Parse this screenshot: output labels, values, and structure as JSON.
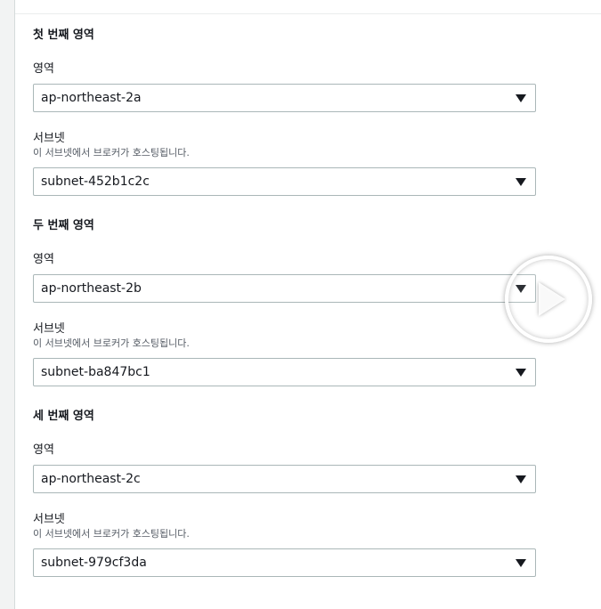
{
  "zones": [
    {
      "title": "첫 번째 영역",
      "az_label": "영역",
      "az_value": "ap-northeast-2a",
      "subnet_label": "서브넷",
      "subnet_desc": "이 서브넷에서 브로커가 호스팅됩니다.",
      "subnet_value": "subnet-452b1c2c"
    },
    {
      "title": "두 번째 영역",
      "az_label": "영역",
      "az_value": "ap-northeast-2b",
      "subnet_label": "서브넷",
      "subnet_desc": "이 서브넷에서 브로커가 호스팅됩니다.",
      "subnet_value": "subnet-ba847bc1"
    },
    {
      "title": "세 번째 영역",
      "az_label": "영역",
      "az_value": "ap-northeast-2c",
      "subnet_label": "서브넷",
      "subnet_desc": "이 서브넷에서 브로커가 호스팅됩니다.",
      "subnet_value": "subnet-979cf3da"
    }
  ],
  "icons": {
    "dropdown": "caret-down-icon",
    "overlay": "play-icon"
  },
  "colors": {
    "border": "#aab7b8",
    "text": "#16191f",
    "muted": "#545b64"
  }
}
